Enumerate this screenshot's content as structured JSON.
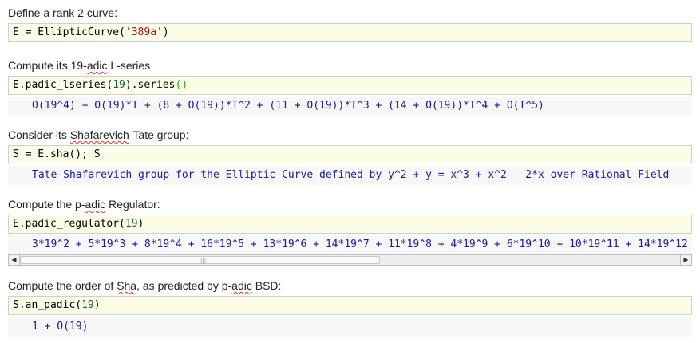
{
  "sections": [
    {
      "label_pre": "Define a rank 2 curve:",
      "input": {
        "a": "E = EllipticCurve(",
        "str": "'389a'",
        "b": ")"
      }
    },
    {
      "label_pre": "Compute its 19-",
      "label_squig": "adic",
      "label_post": " L-series",
      "input": {
        "a": "E.padic_lseries(",
        "num": "19",
        "b": ").series",
        "c": "()"
      },
      "output": "O(19^4) + O(19)*T + (8 + O(19))*T^2 + (11 + O(19))*T^3 + (14 + O(19))*T^4 + O(T^5)"
    },
    {
      "label_pre": "Consider its ",
      "label_squig": "Shafarevich",
      "label_post": "-Tate group:",
      "input": {
        "a": "S = E.sha(); S"
      },
      "output": "Tate-Shafarevich group for the Elliptic Curve defined by y^2 + y = x^3 + x^2 - 2*x over Rational Field"
    },
    {
      "label_pre": "Compute the p-",
      "label_squig": "adic",
      "label_post": " Regulator:",
      "input": {
        "a": "E.padic_regulator(",
        "num": "19",
        "b": ")"
      },
      "output": "3*19^2 + 5*19^3 + 8*19^4 + 16*19^5 + 13*19^6 + 14*19^7 + 11*19^8 + 4*19^9 + 6*19^10 + 10*19^11 + 14*19^12"
    },
    {
      "label_pre": "Compute the order of ",
      "label_squig": "Sha",
      "label_post": ", as predicted by p-",
      "label_squig2": "adic",
      "label_post2": " BSD:",
      "input": {
        "a": "S.an_padic(",
        "num": "19",
        "b": ")"
      },
      "output": "1 + O(19)"
    }
  ],
  "scrollbar": {
    "left_arrow": "◀",
    "right_arrow": "▶",
    "grip": "|||"
  }
}
